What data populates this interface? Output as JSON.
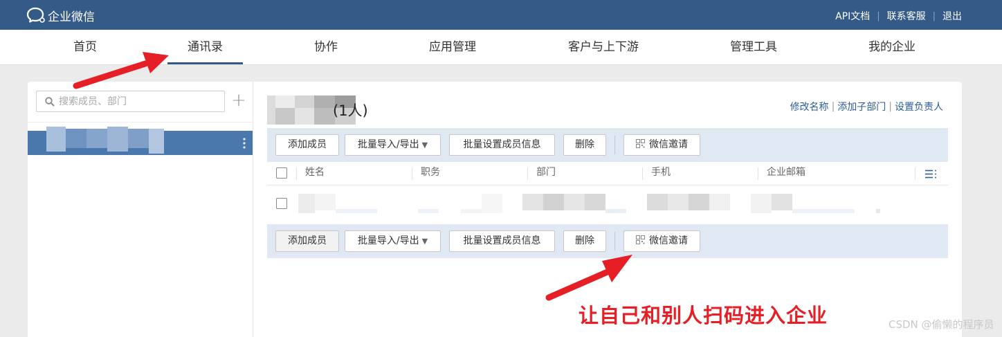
{
  "header": {
    "logo_text": "企业微信",
    "links": [
      "API文档",
      "联系客服",
      "退出"
    ],
    "background_color": "#345a88"
  },
  "nav": {
    "tabs": [
      {
        "label": "首页",
        "active": false
      },
      {
        "label": "通讯录",
        "active": true
      },
      {
        "label": "协作",
        "active": false
      },
      {
        "label": "应用管理",
        "active": false
      },
      {
        "label": "客户与上下游",
        "active": false
      },
      {
        "label": "管理工具",
        "active": false
      },
      {
        "label": "我的企业",
        "active": false
      }
    ]
  },
  "sidebar": {
    "search_placeholder": "搜索成员、部门",
    "add_symbol": "+",
    "selected_dept_color": "#4a78ad"
  },
  "department": {
    "member_count_text": "(1人)",
    "actions": [
      "修改名称",
      "添加子部门",
      "设置负责人"
    ]
  },
  "toolbar": {
    "add_member": "添加成员",
    "batch_import_export": "批量导入/导出",
    "batch_set_info": "批量设置成员信息",
    "delete": "删除",
    "wechat_invite": "微信邀请",
    "dropdown_caret": "▼"
  },
  "table": {
    "columns": [
      "姓名",
      "职务",
      "部门",
      "手机",
      "企业邮箱"
    ]
  },
  "annotation": {
    "caption": "让自己和别人扫码进入企业",
    "arrow_color": "#e61f26"
  },
  "watermark": "CSDN @偷懒的程序员"
}
